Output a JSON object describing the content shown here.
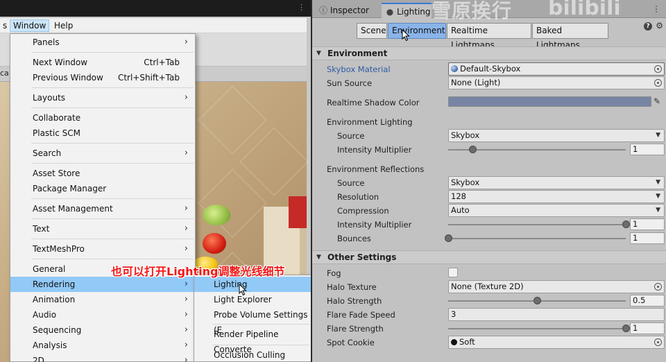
{
  "menubar": {
    "partial_item": "s",
    "window_label": "Window",
    "help_label": "Help"
  },
  "scene": {
    "tab_partial": "ca"
  },
  "window_menu": {
    "items": [
      {
        "label": "Panels",
        "shortcut": "",
        "submenu": true
      },
      {
        "label": "Next Window",
        "shortcut": "Ctrl+Tab",
        "submenu": false
      },
      {
        "label": "Previous Window",
        "shortcut": "Ctrl+Shift+Tab",
        "submenu": false
      },
      {
        "label": "Layouts",
        "shortcut": "",
        "submenu": true
      },
      {
        "label": "Collaborate",
        "shortcut": "",
        "submenu": false
      },
      {
        "label": "Plastic SCM",
        "shortcut": "",
        "submenu": false
      },
      {
        "label": "Search",
        "shortcut": "",
        "submenu": true
      },
      {
        "label": "Asset Store",
        "shortcut": "",
        "submenu": false
      },
      {
        "label": "Package Manager",
        "shortcut": "",
        "submenu": false
      },
      {
        "label": "Asset Management",
        "shortcut": "",
        "submenu": true
      },
      {
        "label": "Text",
        "shortcut": "",
        "submenu": true
      },
      {
        "label": "TextMeshPro",
        "shortcut": "",
        "submenu": true
      },
      {
        "label": "General",
        "shortcut": "",
        "submenu": true
      },
      {
        "label": "Rendering",
        "shortcut": "",
        "submenu": true
      },
      {
        "label": "Animation",
        "shortcut": "",
        "submenu": true
      },
      {
        "label": "Audio",
        "shortcut": "",
        "submenu": true
      },
      {
        "label": "Sequencing",
        "shortcut": "",
        "submenu": true
      },
      {
        "label": "Analysis",
        "shortcut": "",
        "submenu": true
      },
      {
        "label": "2D",
        "shortcut": "",
        "submenu": true
      }
    ]
  },
  "rendering_submenu": {
    "items": [
      {
        "label": "Lighting"
      },
      {
        "label": "Light Explorer"
      },
      {
        "label": "Probe Volume Settings (E"
      },
      {
        "label": "Render Pipeline Converte"
      },
      {
        "label": "Occlusion Culling"
      }
    ]
  },
  "caption": "也可以打开Lighting调整光线细节",
  "watermark": {
    "cjk": "雪原挨行",
    "latin": "bilibili"
  },
  "tabs": {
    "inspector": "Inspector",
    "lighting": "Lighting"
  },
  "segments": [
    "Scene",
    "Environment",
    "Realtime Lightmaps",
    "Baked Lightmaps"
  ],
  "environment": {
    "header": "Environment",
    "skybox_label": "Skybox Material",
    "skybox_value": "Default-Skybox",
    "sun_label": "Sun Source",
    "sun_value": "None (Light)",
    "shadow_label": "Realtime Shadow Color",
    "shadow_color": "#7784a3",
    "env_lighting_label": "Environment Lighting",
    "light_source_label": "Source",
    "light_source_value": "Skybox",
    "light_intensity_label": "Intensity Multiplier",
    "light_intensity_value": "1",
    "env_reflections_label": "Environment Reflections",
    "refl_source_label": "Source",
    "refl_source_value": "Skybox",
    "resolution_label": "Resolution",
    "resolution_value": "128",
    "compression_label": "Compression",
    "compression_value": "Auto",
    "refl_intensity_label": "Intensity Multiplier",
    "refl_intensity_value": "1",
    "bounces_label": "Bounces",
    "bounces_value": "1"
  },
  "other": {
    "header": "Other Settings",
    "fog_label": "Fog",
    "halo_texture_label": "Halo Texture",
    "halo_texture_value": "None (Texture 2D)",
    "halo_strength_label": "Halo Strength",
    "halo_strength_value": "0.5",
    "flare_speed_label": "Flare Fade Speed",
    "flare_speed_value": "3",
    "flare_strength_label": "Flare Strength",
    "flare_strength_value": "1",
    "spot_cookie_label": "Spot Cookie",
    "spot_cookie_value": "Soft"
  },
  "sliders": {
    "light_intensity": 0.14,
    "refl_intensity": 1.0,
    "bounces": 0.0,
    "halo_strength": 0.5,
    "flare_strength": 1.0
  }
}
